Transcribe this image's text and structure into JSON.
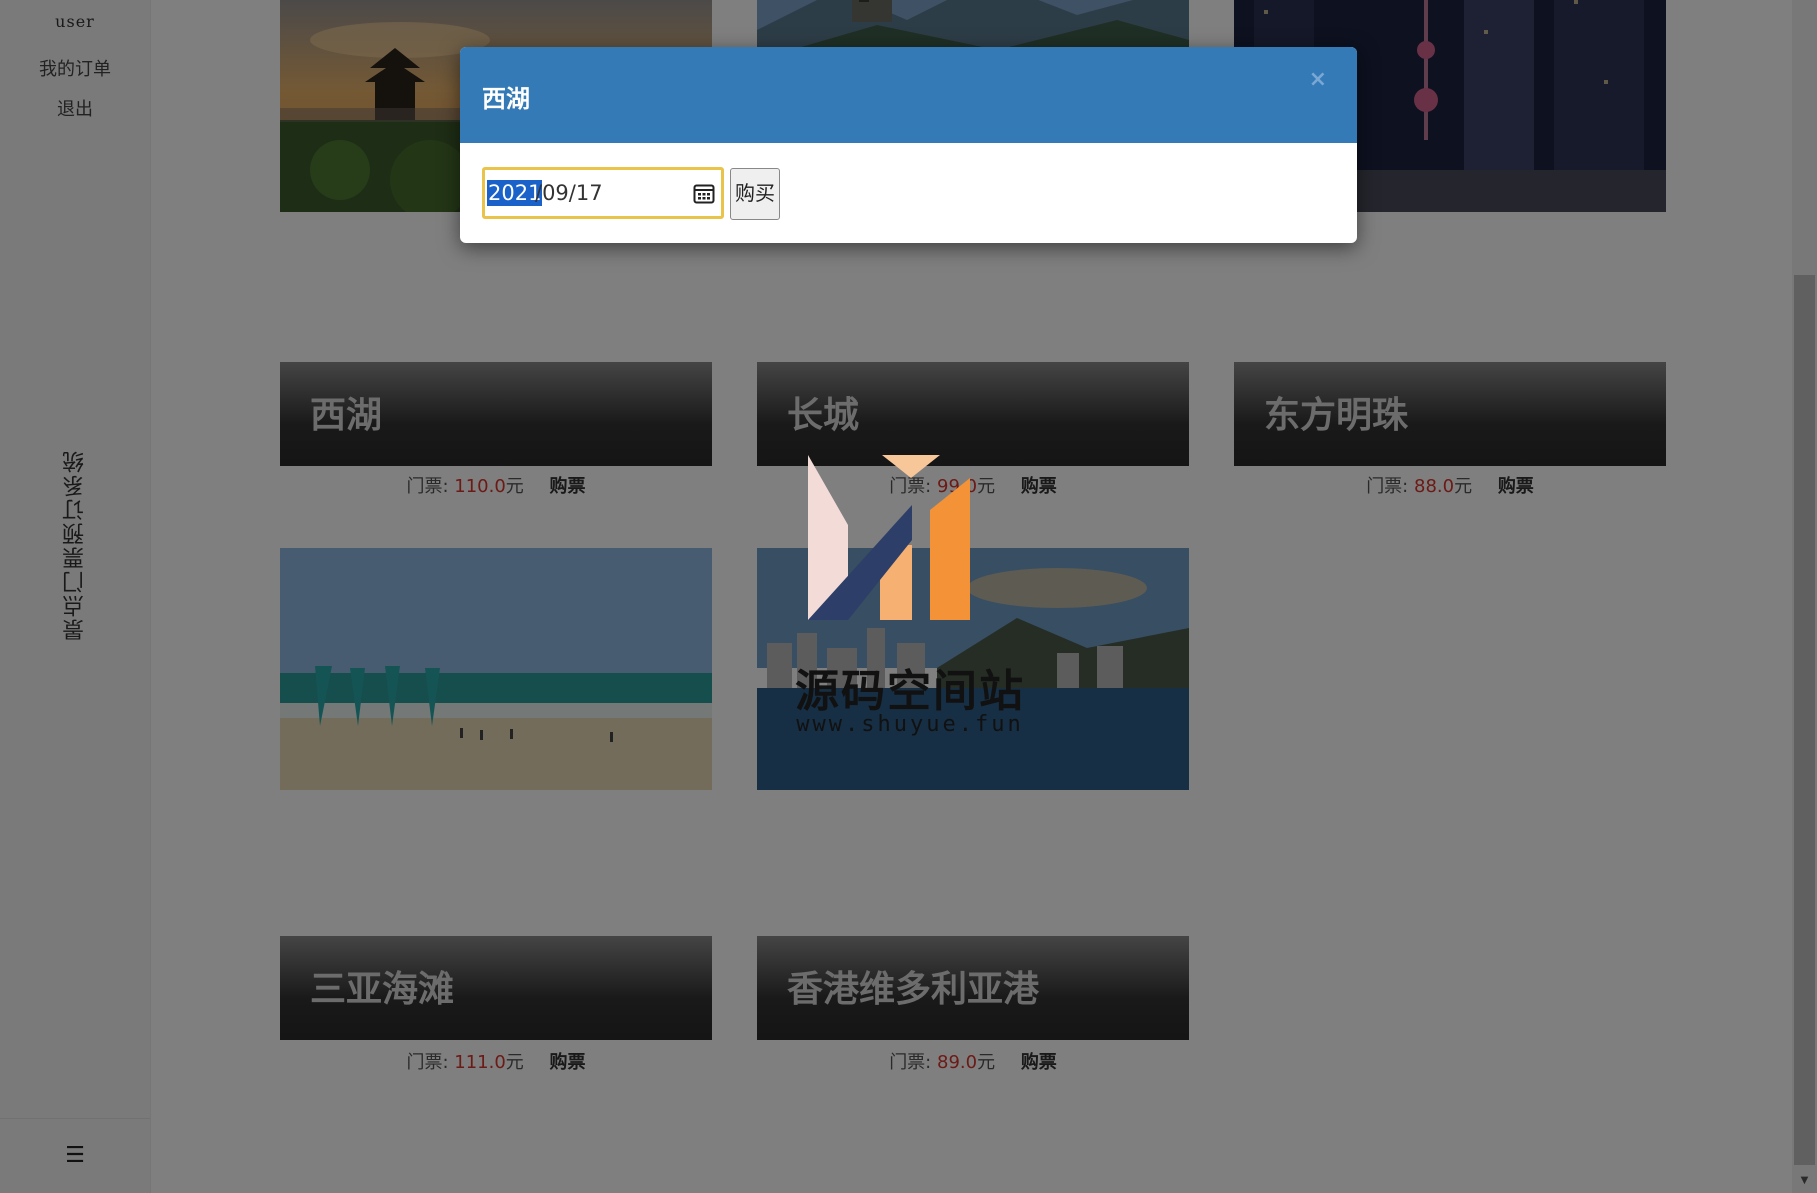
{
  "sidebar": {
    "user": "user",
    "my_orders": "我的订单",
    "logout": "退出",
    "system_title": "景点门票预订系统",
    "menu_icon": "hamburger-menu-icon"
  },
  "attractions": [
    {
      "name": "西湖",
      "price_label": "门票:",
      "price_value": "110.0",
      "currency": "元",
      "buy": "购票",
      "photo": "pavilion-lotus-sunset"
    },
    {
      "name": "长城",
      "price_label": "门票:",
      "price_value": "99.0",
      "currency": "元",
      "buy": "购票",
      "photo": "great-wall-mountains"
    },
    {
      "name": "东方明珠",
      "price_label": "门票:",
      "price_value": "88.0",
      "currency": "元",
      "buy": "购票",
      "photo": "shanghai-night-skyline"
    },
    {
      "name": "三亚海滩",
      "price_label": "门票:",
      "price_value": "111.0",
      "currency": "元",
      "buy": "购票",
      "photo": "beach-sailboats"
    },
    {
      "name": "香港维多利亚港",
      "price_label": "门票:",
      "price_value": "89.0",
      "currency": "元",
      "buy": "购票",
      "photo": "victoria-harbour-skyline"
    }
  ],
  "modal": {
    "title": "西湖",
    "close": "×",
    "date_year": "2021",
    "date_rest": "/09/17",
    "buy_button": "购买",
    "calendar_icon": "calendar-icon"
  },
  "watermark": {
    "text": "源码空间站",
    "url": "www.shuyue.fun"
  },
  "colors": {
    "modal_header": "#337ab7",
    "price_red": "#d9342b",
    "input_focus": "#e9c34a",
    "selection": "#1a62c9"
  }
}
